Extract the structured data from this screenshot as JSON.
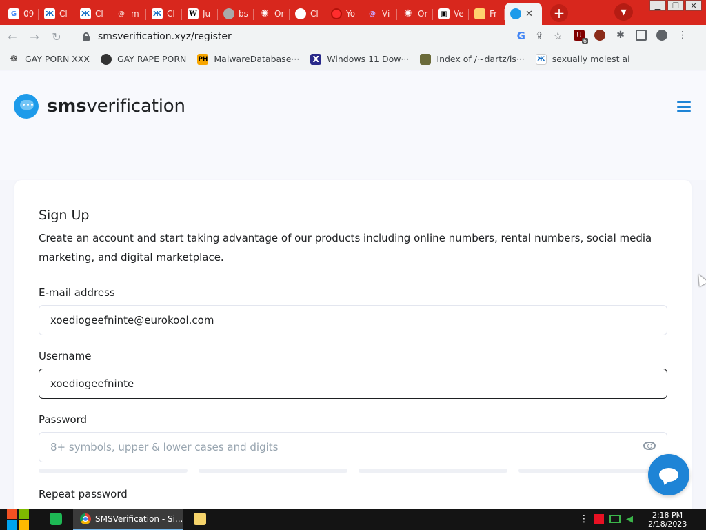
{
  "browser": {
    "tabs": [
      {
        "title": "09",
        "icon": "google-icon"
      },
      {
        "title": "Cl",
        "icon": "figure-icon"
      },
      {
        "title": "Cl",
        "icon": "figure-icon"
      },
      {
        "title": "m",
        "icon": "at-icon"
      },
      {
        "title": "Cl",
        "icon": "figure-icon"
      },
      {
        "title": "Ju",
        "icon": "wikipedia-icon"
      },
      {
        "title": "bs",
        "icon": "globe-icon"
      },
      {
        "title": "Or",
        "icon": "openai-icon"
      },
      {
        "title": "Cl",
        "icon": "github-icon"
      },
      {
        "title": "Yo",
        "icon": "red-drop-icon"
      },
      {
        "title": "Vi",
        "icon": "at-purple-icon"
      },
      {
        "title": "Or",
        "icon": "openai-icon"
      },
      {
        "title": "Ve",
        "icon": "film-icon"
      },
      {
        "title": "Fr",
        "icon": "folder-icon"
      }
    ],
    "active_tab_close": "✕",
    "new_tab": "+",
    "url": "smsverification.xyz/register",
    "window_buttons": [
      "▁",
      "❐",
      "✕"
    ],
    "extension_badge": "6",
    "bookmarks": [
      {
        "label": "GAY PORN XXX",
        "icon": "paw-icon"
      },
      {
        "label": "GAY RAPE PORN",
        "icon": "circle-icon"
      },
      {
        "label": "MalwareDatabase···",
        "icon": "ph-icon"
      },
      {
        "label": "Windows 11 Dow···",
        "icon": "x-icon"
      },
      {
        "label": "Index of /~dartz/is···",
        "icon": "tank-icon"
      },
      {
        "label": "sexually molest ai",
        "icon": "figure-icon"
      }
    ]
  },
  "site": {
    "brand_bold": "sms",
    "brand_rest": "verification"
  },
  "form": {
    "title": "Sign Up",
    "description": "Create an account and start taking advantage of our products including online numbers, rental numbers, social media marketing, and digital marketplace.",
    "email_label": "E-mail address",
    "email_value": "xoediogeefninte@eurokool.com",
    "username_label": "Username",
    "username_value": "xoediogeefninte",
    "password_label": "Password",
    "password_placeholder": "8+ symbols, upper & lower cases and digits",
    "repeat_password_label": "Repeat password"
  },
  "taskbar": {
    "chrome_title": "SMSVerification - Si...",
    "time": "2:18 PM",
    "date": "2/18/2023"
  },
  "colors": {
    "tab_strip": "#d8271d",
    "accent": "#1e84d6",
    "logo": "#1e9bea"
  }
}
